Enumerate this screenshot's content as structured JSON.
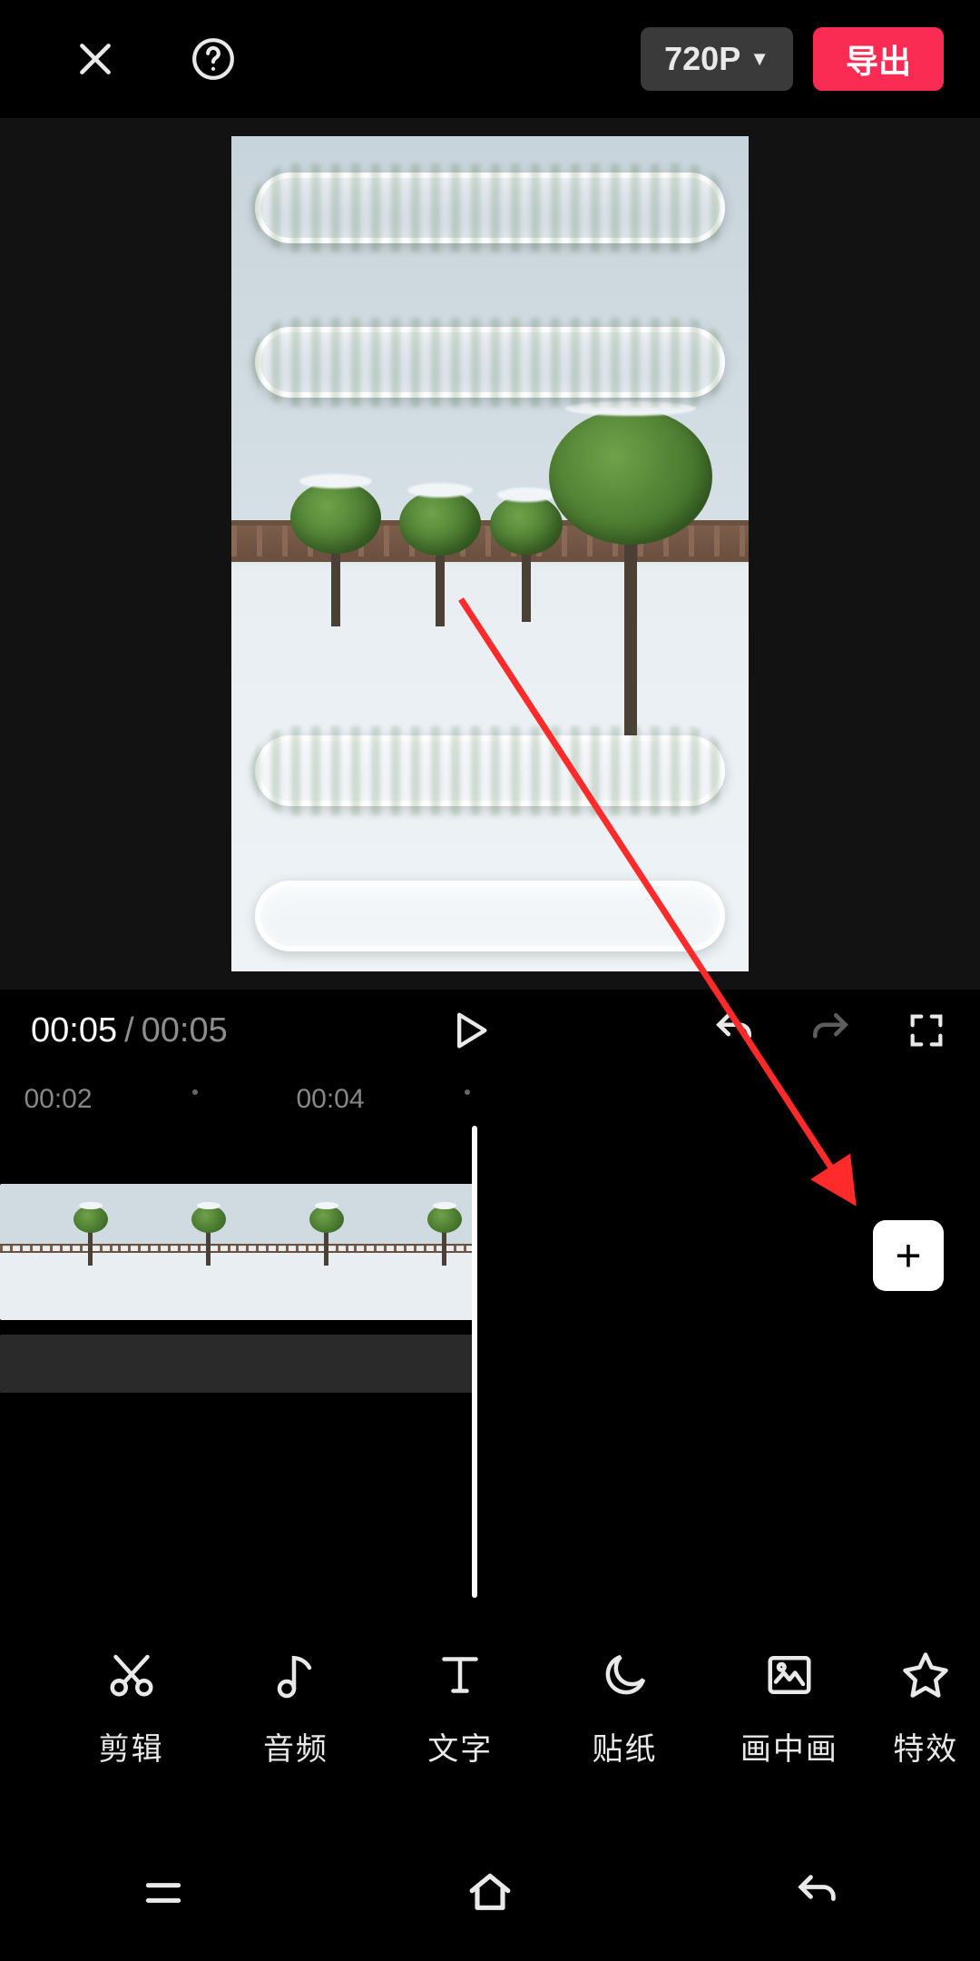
{
  "header": {
    "resolution_label": "720P",
    "export_label": "导出"
  },
  "player": {
    "current_time": "00:05",
    "separator": "/",
    "total_time": "00:05"
  },
  "ruler": {
    "marks": [
      "00:02",
      "00:04"
    ]
  },
  "add_button_label": "+",
  "tools": [
    {
      "id": "cut",
      "label": "剪辑",
      "icon": "scissors"
    },
    {
      "id": "audio",
      "label": "音频",
      "icon": "note"
    },
    {
      "id": "text",
      "label": "文字",
      "icon": "T"
    },
    {
      "id": "sticker",
      "label": "贴纸",
      "icon": "moon"
    },
    {
      "id": "pip",
      "label": "画中画",
      "icon": "pip"
    },
    {
      "id": "effects",
      "label": "特效",
      "icon": "star"
    }
  ],
  "colors": {
    "accent": "#fb2c54"
  }
}
